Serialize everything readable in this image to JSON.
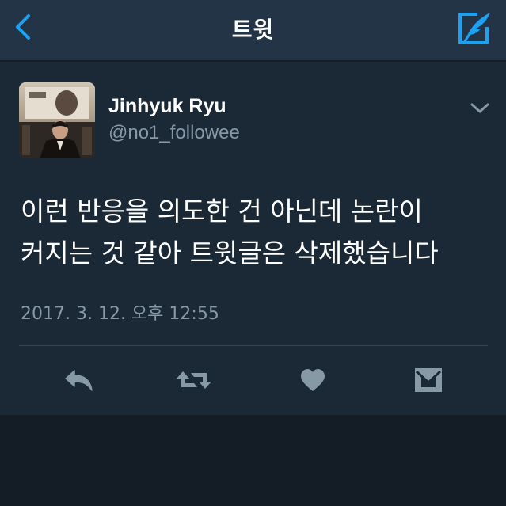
{
  "navbar": {
    "title": "트윗",
    "back_icon": "chevron-left-icon",
    "compose_icon": "compose-tweet-icon",
    "accent_color": "#1da1f2"
  },
  "tweet": {
    "author": {
      "display_name": "Jinhyuk Ryu",
      "handle": "@no1_followee"
    },
    "text_lines": [
      "이런 반응을 의도한 건 아닌데 논란이",
      "커지는 것 같아 트윗글은 삭제했습니다"
    ],
    "timestamp": "2017. 3. 12. 오후 12:55",
    "actions": [
      {
        "name": "reply",
        "icon": "reply-icon"
      },
      {
        "name": "retweet",
        "icon": "retweet-icon"
      },
      {
        "name": "like",
        "icon": "heart-icon"
      },
      {
        "name": "direct-message",
        "icon": "envelope-icon"
      }
    ]
  },
  "colors": {
    "background": "#1b2836",
    "navbar": "#243447",
    "text_primary": "#ffffff",
    "text_secondary": "#8899a6",
    "icon": "#8899a6"
  }
}
